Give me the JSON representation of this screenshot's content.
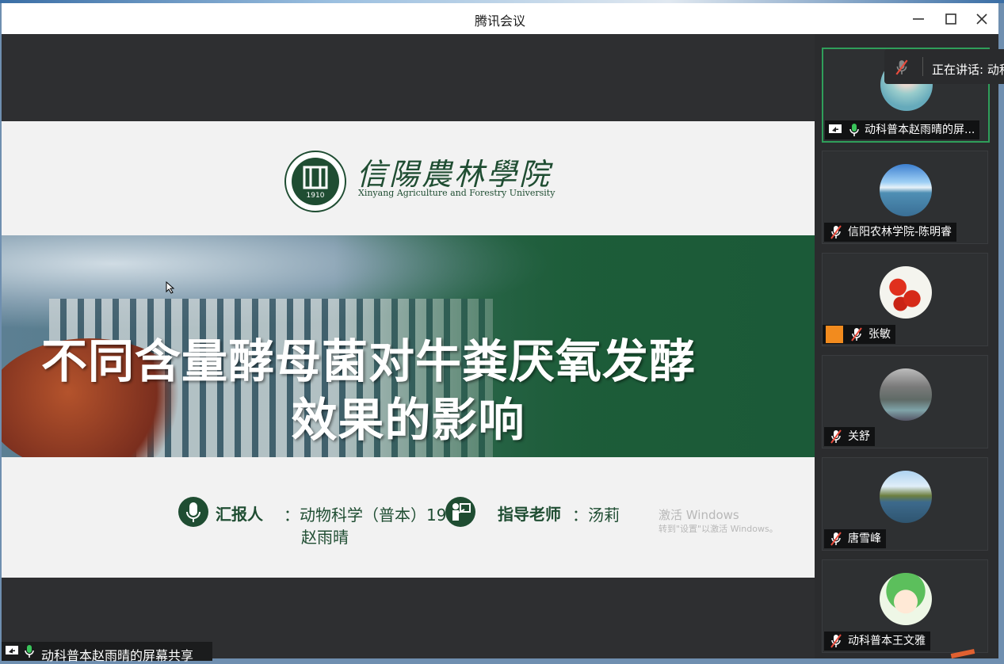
{
  "window": {
    "title": "腾讯会议"
  },
  "slide": {
    "university_cn": "信陽農林學院",
    "university_en": "Xinyang Agriculture and Forestry University",
    "logo_year": "1910",
    "title_line1": "不同含量酵母菌对牛粪厌氧发酵",
    "title_line2": "效果的影响",
    "reporter_label": "汇报人",
    "reporter_value": "：动物科学（普本）19",
    "reporter_name": "赵雨晴",
    "teacher_label": "指导老师",
    "teacher_value": "：汤莉"
  },
  "activation": {
    "line1": "激活 Windows",
    "line2": "转到\"设置\"以激活 Windows。"
  },
  "share_bar": {
    "label": "动科普本赵雨晴的屏幕共享"
  },
  "speaking": {
    "label": "正在讲话: 动科"
  },
  "participants": [
    {
      "name": "动科普本赵雨晴的屏...",
      "mic": "on",
      "sharing": true,
      "avatar": "girl-photo"
    },
    {
      "name": "信阳农林学院-陈明睿",
      "mic": "muted",
      "avatar": "lake-mountain"
    },
    {
      "name": "张敏",
      "mic": "muted",
      "avatar": "cherries",
      "has_user_badge": true
    },
    {
      "name": "关舒",
      "mic": "muted",
      "avatar": "rock-lake"
    },
    {
      "name": "唐雪峰",
      "mic": "muted",
      "avatar": "lake-trees"
    },
    {
      "name": "动科普本王文雅",
      "mic": "muted",
      "avatar": "cartoon-girl"
    }
  ],
  "colors": {
    "slide_green": "#1f4d32",
    "active_border": "#2f9e5a",
    "mic_on": "#39c45a"
  },
  "icons": [
    "minimize-icon",
    "maximize-icon",
    "close-icon",
    "mic-muted-icon",
    "mic-on-icon",
    "screen-share-icon",
    "cursor-icon"
  ]
}
